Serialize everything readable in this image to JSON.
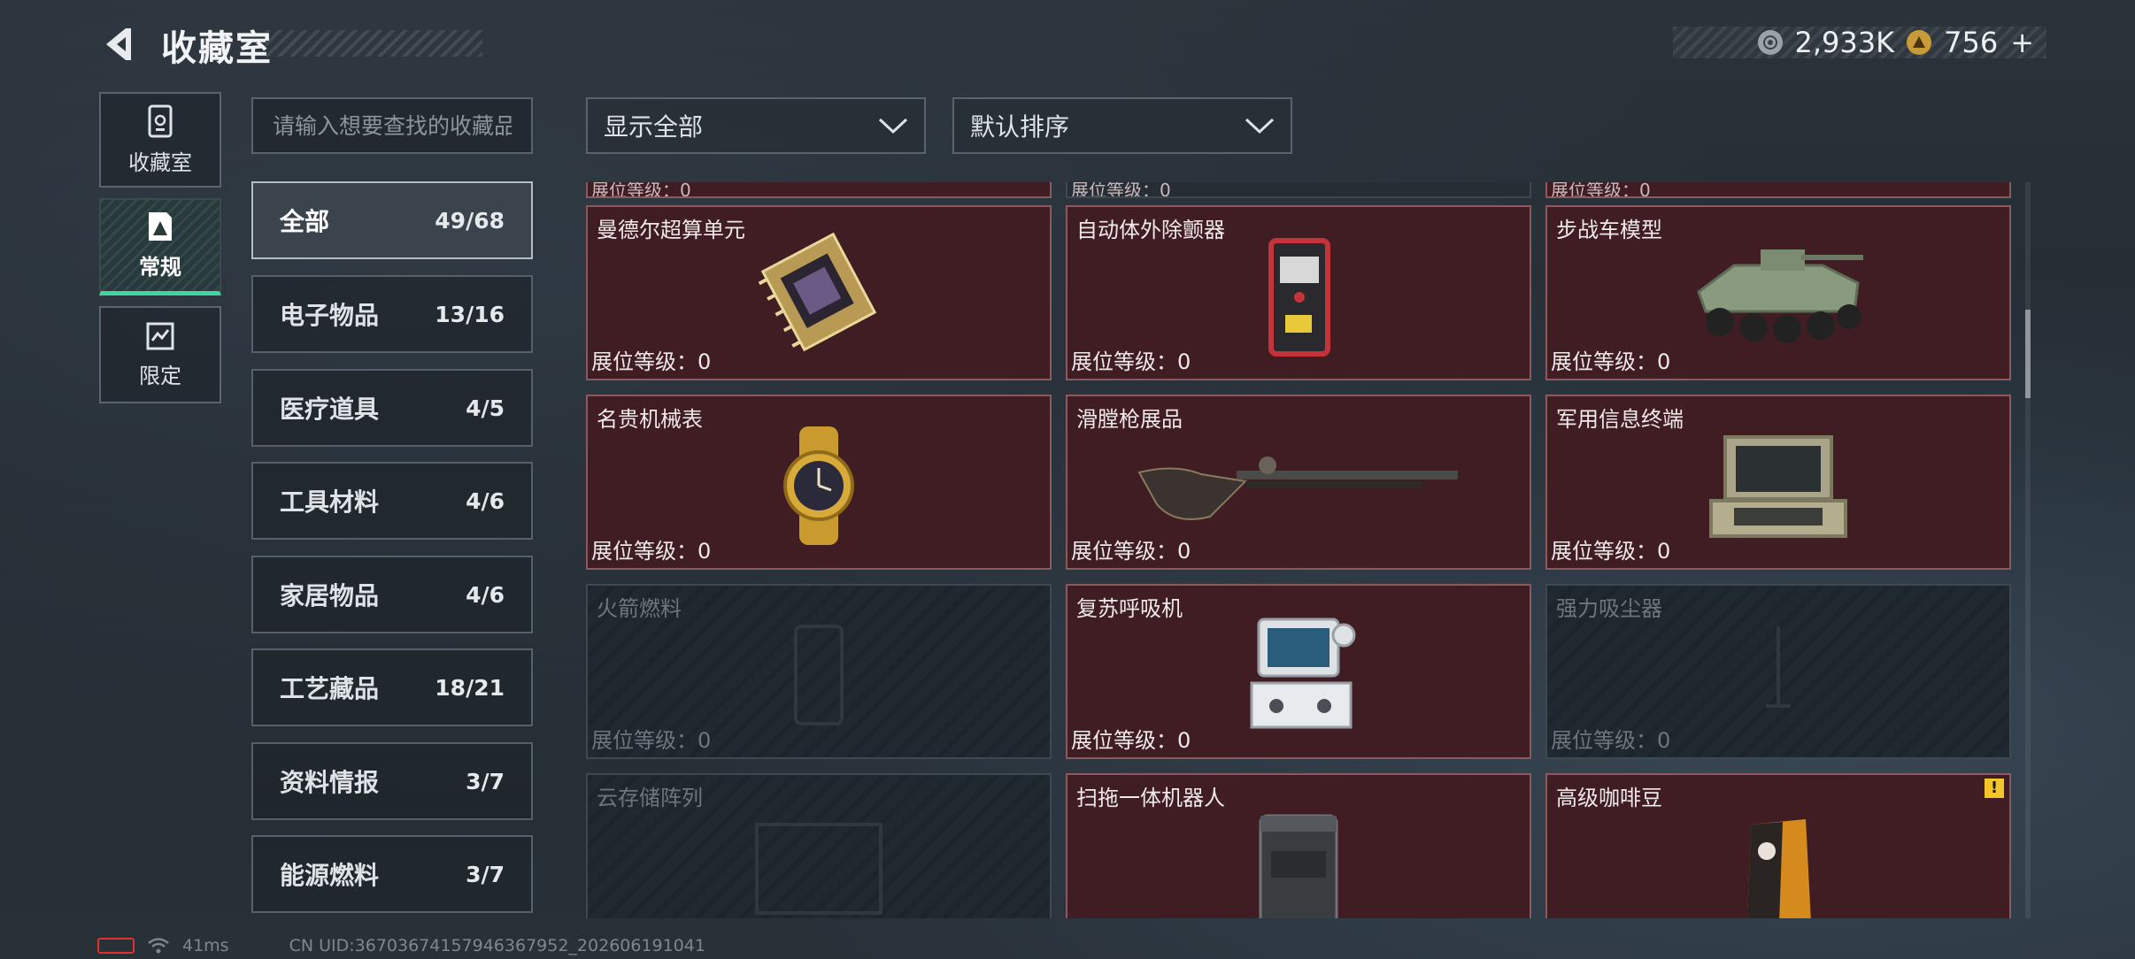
{
  "header": {
    "title": "收藏室",
    "currency_1": "2,933K",
    "currency_2": "756",
    "add_symbol": "+"
  },
  "rail": [
    {
      "label": "收藏室",
      "icon": "collection-room-icon"
    },
    {
      "label": "常规",
      "icon": "regular-icon",
      "active": true
    },
    {
      "label": "限定",
      "icon": "limited-icon"
    }
  ],
  "search": {
    "placeholder": "请输入想要查找的收藏品"
  },
  "categories": [
    {
      "name": "全部",
      "count": "49/68",
      "active": true
    },
    {
      "name": "电子物品",
      "count": "13/16"
    },
    {
      "name": "医疗道具",
      "count": "4/5"
    },
    {
      "name": "工具材料",
      "count": "4/6"
    },
    {
      "name": "家居物品",
      "count": "4/6"
    },
    {
      "name": "工艺藏品",
      "count": "18/21"
    },
    {
      "name": "资料情报",
      "count": "3/7"
    },
    {
      "name": "能源燃料",
      "count": "3/7"
    }
  ],
  "filters": {
    "show": "显示全部",
    "sort": "默认排序"
  },
  "partial_label": "展位等级：0",
  "items": [
    {
      "name": "曼德尔超算单元",
      "level": "展位等级：0",
      "owned": true
    },
    {
      "name": "自动体外除颤器",
      "level": "展位等级：0",
      "owned": true
    },
    {
      "name": "步战车模型",
      "level": "展位等级：0",
      "owned": true
    },
    {
      "name": "名贵机械表",
      "level": "展位等级：0",
      "owned": true
    },
    {
      "name": "滑膛枪展品",
      "level": "展位等级：0",
      "owned": true
    },
    {
      "name": "军用信息终端",
      "level": "展位等级：0",
      "owned": true
    },
    {
      "name": "火箭燃料",
      "level": "展位等级：0",
      "owned": false
    },
    {
      "name": "复苏呼吸机",
      "level": "展位等级：0",
      "owned": true
    },
    {
      "name": "强力吸尘器",
      "level": "展位等级：0",
      "owned": false
    },
    {
      "name": "云存储阵列",
      "level": "",
      "owned": false
    },
    {
      "name": "扫拖一体机器人",
      "level": "",
      "owned": true
    },
    {
      "name": "高级咖啡豆",
      "level": "",
      "owned": true,
      "warning": "!"
    }
  ],
  "status": {
    "ping": "41ms",
    "uid": "CN UID:36703674157946367952_202606191041"
  },
  "colors": {
    "owned_bg": "#3f1d23",
    "locked_bg": "#1d252c",
    "active_accent": "#3fd79b",
    "warning": "#f3c52a"
  }
}
